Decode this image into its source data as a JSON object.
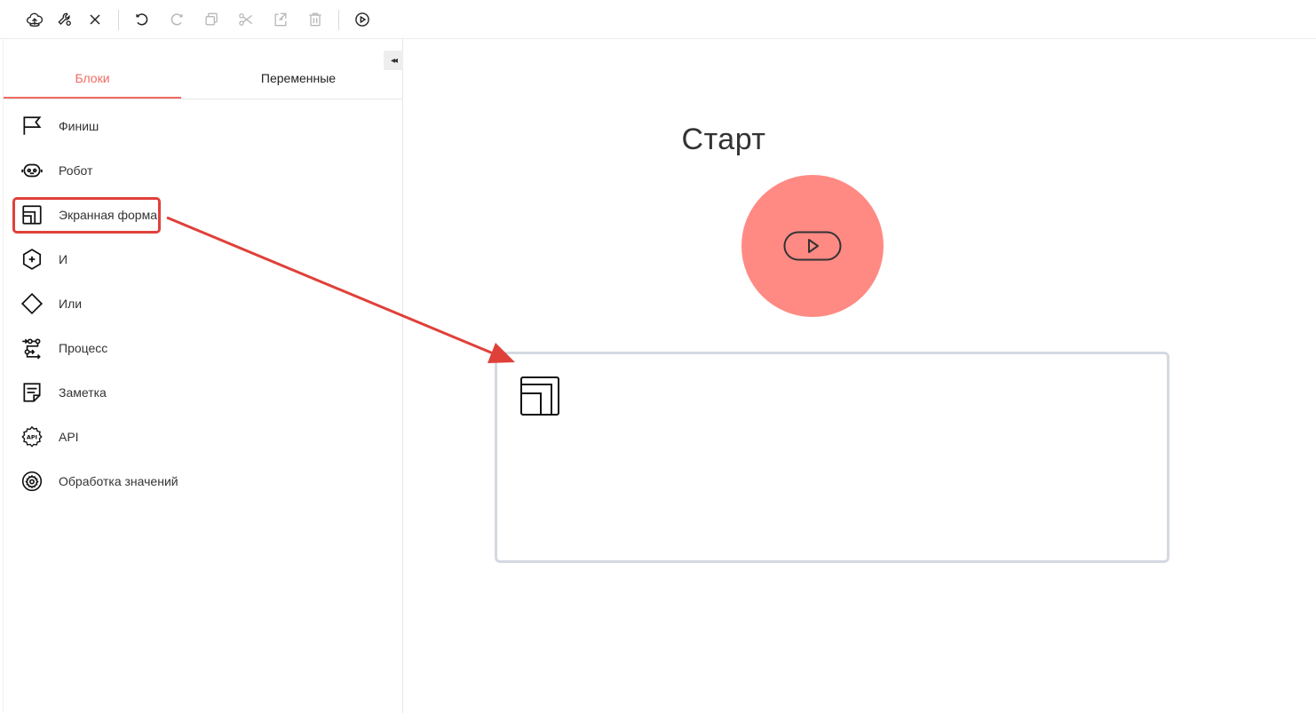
{
  "toolbar": {
    "buttons": [
      "cloud-upload-icon",
      "wrench-settings-icon",
      "close-icon",
      "undo-icon",
      "redo-icon",
      "copy-icon",
      "cut-icon",
      "paste-icon",
      "delete-icon",
      "play-icon"
    ]
  },
  "sidebar": {
    "collapse_label": "◂◂",
    "tabs": [
      {
        "label": "Блоки",
        "active": true
      },
      {
        "label": "Переменные",
        "active": false
      }
    ],
    "blocks": [
      {
        "label": "Финиш",
        "icon": "flag-icon"
      },
      {
        "label": "Робот",
        "icon": "robot-icon"
      },
      {
        "label": "Экранная форма",
        "icon": "screen-form-icon"
      },
      {
        "label": "И",
        "icon": "and-hexagon-icon"
      },
      {
        "label": "Или",
        "icon": "or-diamond-icon"
      },
      {
        "label": "Процесс",
        "icon": "process-icon"
      },
      {
        "label": "Заметка",
        "icon": "note-icon"
      },
      {
        "label": "API",
        "icon": "api-gear-icon"
      },
      {
        "label": "Обработка значений",
        "icon": "value-processing-icon"
      }
    ]
  },
  "canvas": {
    "start_title": "Старт"
  },
  "colors": {
    "accent": "#ef6a63",
    "start_node": "#ff8a84",
    "highlight": "#e0403a",
    "node_border": "#d4d9e1"
  }
}
